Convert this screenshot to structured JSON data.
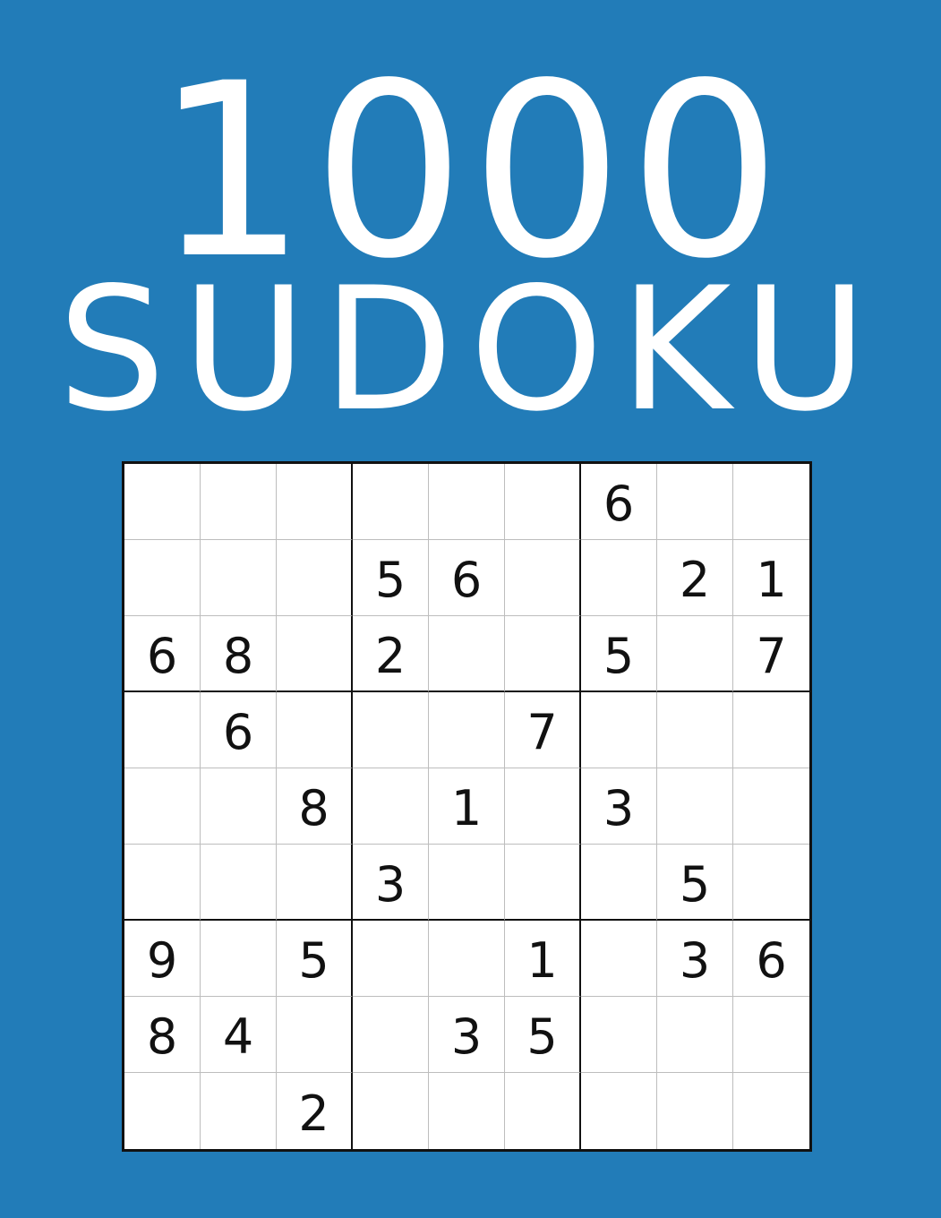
{
  "cover": {
    "background_color": "#227cb8",
    "title_number": "1000",
    "title_word": "SUDOKU"
  },
  "puzzle": {
    "rows": [
      [
        "",
        "",
        "",
        "",
        "",
        "",
        "6",
        "",
        ""
      ],
      [
        "",
        "",
        "",
        "5",
        "6",
        "",
        "",
        "2",
        "1"
      ],
      [
        "6",
        "8",
        "",
        "2",
        "",
        "",
        "5",
        "",
        "7"
      ],
      [
        "",
        "6",
        "",
        "",
        "",
        "7",
        "",
        "",
        ""
      ],
      [
        "",
        "",
        "8",
        "",
        "1",
        "",
        "3",
        "",
        ""
      ],
      [
        "",
        "",
        "",
        "3",
        "",
        "",
        "",
        "5",
        ""
      ],
      [
        "9",
        "",
        "5",
        "",
        "",
        "1",
        "",
        "3",
        "6"
      ],
      [
        "8",
        "4",
        "",
        "",
        "3",
        "5",
        "",
        "",
        ""
      ],
      [
        "",
        "",
        "2",
        "",
        "",
        "",
        "",
        "",
        ""
      ]
    ]
  }
}
